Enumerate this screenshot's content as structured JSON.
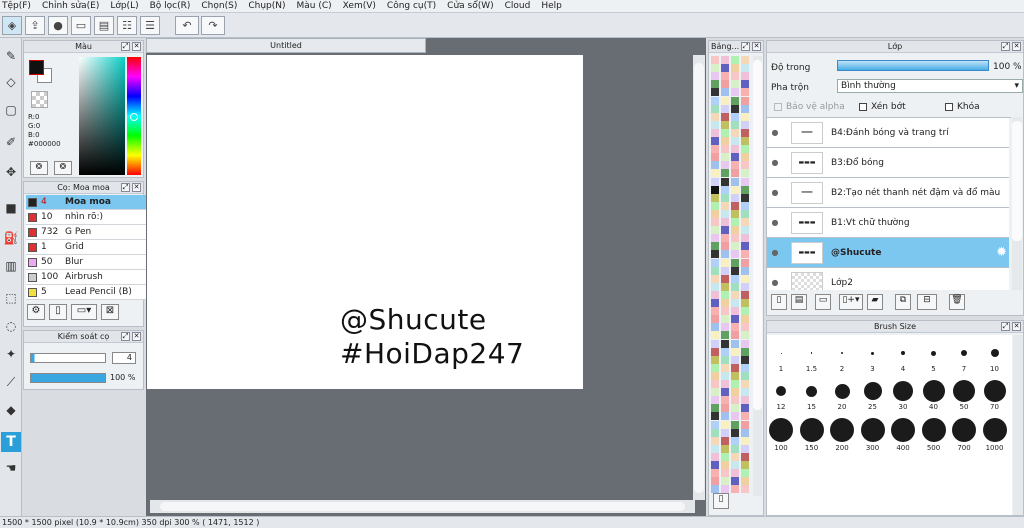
{
  "menu": [
    "Tệp(F)",
    "Chỉnh sửa(E)",
    "Lớp(L)",
    "Bộ lọc(R)",
    "Chọn(S)",
    "Chụp(N)",
    "Màu (C)",
    "Xem(V)",
    "Công cụ(T)",
    "Cửa sổ(W)",
    "Cloud",
    "Help"
  ],
  "color_panel": {
    "title": "Màu",
    "r": "R:0",
    "g": "G:0",
    "b": "B:0",
    "hex": "#000000"
  },
  "brush_panel": {
    "title": "Cọ: Moa moa",
    "items": [
      {
        "size": "4",
        "name": "Moa moa",
        "color": "#222222"
      },
      {
        "size": "10",
        "name": "nhìn rõ:)",
        "color": "#e03030"
      },
      {
        "size": "732",
        "name": "G Pen",
        "color": "#e03030"
      },
      {
        "size": "1",
        "name": "Grid",
        "color": "#e03030"
      },
      {
        "size": "50",
        "name": "Blur",
        "color": "#f0a8f0"
      },
      {
        "size": "100",
        "name": "Airbrush",
        "color": "#cccccc"
      },
      {
        "size": "5",
        "name": "Lead Pencil (B)",
        "color": "#f0e040"
      }
    ]
  },
  "brush_control": {
    "title": "Kiểm soát cọ",
    "size": "4",
    "opacity": "100 %"
  },
  "document": {
    "tab": "Untitled",
    "line1": "@Shucute",
    "line2": "#HoiDap247"
  },
  "swatch_panel": {
    "title": "Bảng..."
  },
  "layer_panel": {
    "title": "Lớp",
    "opacity_label": "Độ trong",
    "opacity_value": "100 %",
    "blend_label": "Pha trộn",
    "blend_value": "Bình thường",
    "protect_alpha": "Bảo vệ alpha",
    "clip": "Xén bớt",
    "lock": "Khóa",
    "layers": [
      {
        "name": "B4:Đánh bóng và trang trí"
      },
      {
        "name": "B3:Đổ bóng"
      },
      {
        "name": "B2:Tạo nét thanh nét đậm và đổ màu"
      },
      {
        "name": "B1:Vt chữ thường"
      },
      {
        "name": "@Shucute"
      },
      {
        "name": "Lớp2"
      }
    ]
  },
  "brush_size_panel": {
    "title": "Brush Size",
    "sizes": [
      "1",
      "1.5",
      "2",
      "3",
      "4",
      "5",
      "7",
      "10",
      "12",
      "15",
      "20",
      "25",
      "30",
      "40",
      "50",
      "70",
      "100",
      "150",
      "200",
      "300",
      "400",
      "500",
      "700",
      "1000"
    ]
  },
  "status": "1500 * 1500 pixel   (10.9 * 10.9cm)   350 dpi   300 %   ( 1471, 1512 )"
}
